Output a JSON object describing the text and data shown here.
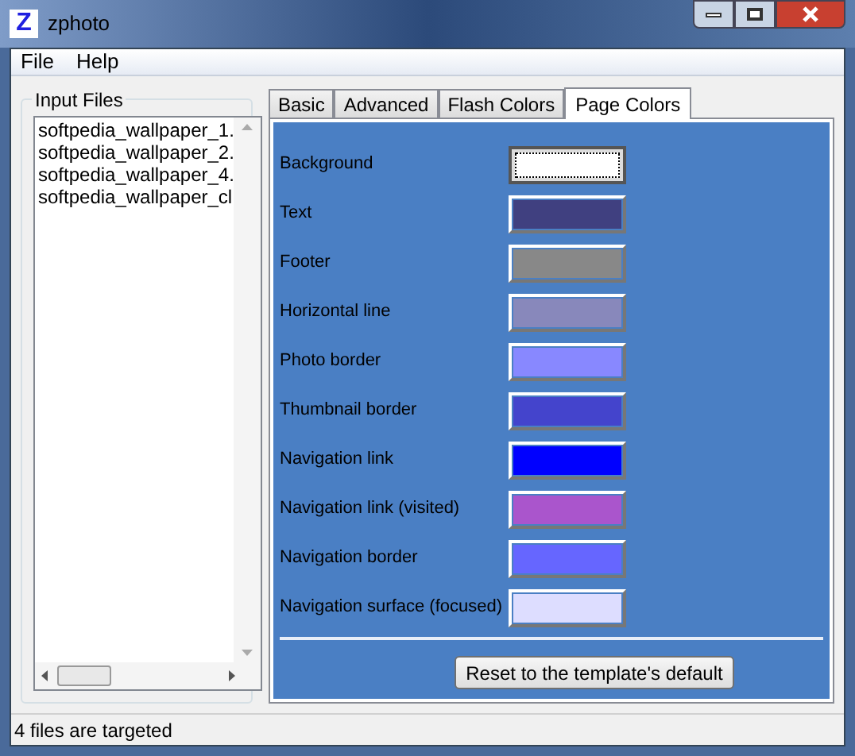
{
  "window": {
    "title": "zphoto",
    "logo": "Z"
  },
  "menu": [
    "File",
    "Help"
  ],
  "input_files": {
    "title": "Input Files",
    "items": [
      "softpedia_wallpaper_1.",
      "softpedia_wallpaper_2.",
      "softpedia_wallpaper_4.",
      "softpedia_wallpaper_cl"
    ]
  },
  "tabs": [
    {
      "label": "Basic",
      "selected": false
    },
    {
      "label": "Advanced",
      "selected": false
    },
    {
      "label": "Flash Colors",
      "selected": false
    },
    {
      "label": "Page Colors",
      "selected": true
    }
  ],
  "page_colors": [
    {
      "label": "Background",
      "color": "#ffffff",
      "focused": true
    },
    {
      "label": "Text",
      "color": "#404080",
      "focused": false
    },
    {
      "label": "Footer",
      "color": "#888888",
      "focused": false
    },
    {
      "label": "Horizontal line",
      "color": "#8888bb",
      "focused": false
    },
    {
      "label": "Photo border",
      "color": "#8888ff",
      "focused": false
    },
    {
      "label": "Thumbnail border",
      "color": "#4444cc",
      "focused": false
    },
    {
      "label": "Navigation link",
      "color": "#0000ff",
      "focused": false
    },
    {
      "label": "Navigation link (visited)",
      "color": "#aa55cc",
      "focused": false
    },
    {
      "label": "Navigation border",
      "color": "#6666ff",
      "focused": false
    },
    {
      "label": "Navigation surface (focused)",
      "color": "#ddddff",
      "focused": false
    }
  ],
  "reset_button": "Reset to the template's default",
  "status_bar": "4 files are targeted"
}
